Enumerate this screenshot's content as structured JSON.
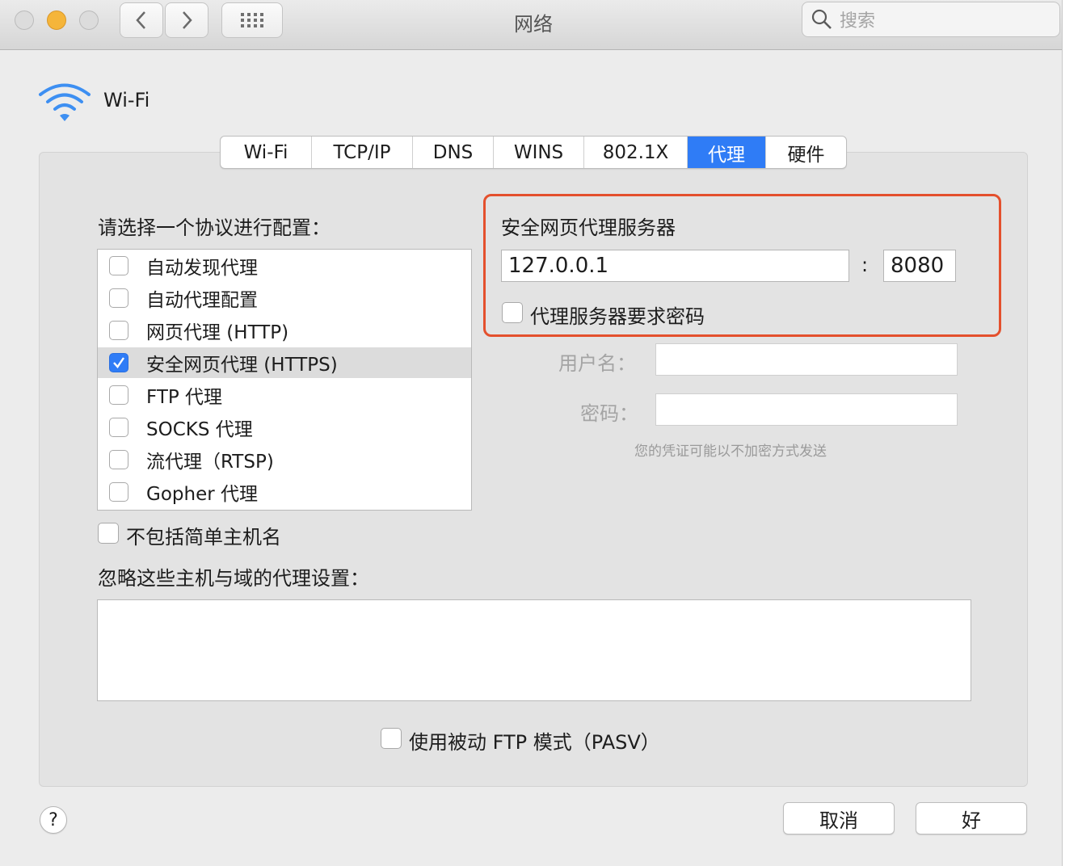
{
  "window": {
    "title": "网络",
    "search_placeholder": "搜索"
  },
  "header": {
    "interface_name": "Wi-Fi"
  },
  "tabs": [
    {
      "label": "Wi-Fi",
      "active": false
    },
    {
      "label": "TCP/IP",
      "active": false
    },
    {
      "label": "DNS",
      "active": false
    },
    {
      "label": "WINS",
      "active": false
    },
    {
      "label": "802.1X",
      "active": false
    },
    {
      "label": "代理",
      "active": true
    },
    {
      "label": "硬件",
      "active": false
    }
  ],
  "protocols": {
    "heading": "请选择一个协议进行配置：",
    "items": [
      {
        "label": "自动发现代理",
        "checked": false
      },
      {
        "label": "自动代理配置",
        "checked": false
      },
      {
        "label": "网页代理 (HTTP)",
        "checked": false
      },
      {
        "label": "安全网页代理 (HTTPS)",
        "checked": true,
        "selected": true
      },
      {
        "label": "FTP 代理",
        "checked": false
      },
      {
        "label": "SOCKS 代理",
        "checked": false
      },
      {
        "label": "流代理（RTSP)",
        "checked": false
      },
      {
        "label": "Gopher 代理",
        "checked": false
      }
    ]
  },
  "proxy_server": {
    "heading": "安全网页代理服务器",
    "host": "127.0.0.1",
    "separator": ":",
    "port": "8080",
    "requires_password_label": "代理服务器要求密码",
    "requires_password": false,
    "username_label": "用户名：",
    "password_label": "密码：",
    "username": "",
    "password": "",
    "hint": "您的凭证可能以不加密方式发送"
  },
  "exclude_simple_hostnames": {
    "label": "不包括简单主机名",
    "checked": false
  },
  "bypass": {
    "heading": "忽略这些主机与域的代理设置：",
    "value": ""
  },
  "passive_ftp": {
    "label": "使用被动 FTP 模式（PASV）",
    "checked": false
  },
  "footer": {
    "help": "?",
    "cancel": "取消",
    "ok": "好"
  },
  "colors": {
    "accent": "#2f7cf6",
    "highlight_border": "#e4502d"
  }
}
